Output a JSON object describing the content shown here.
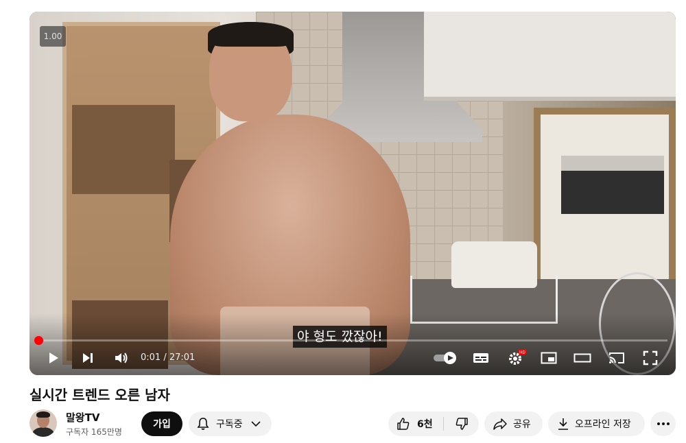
{
  "player": {
    "speed_badge": "1.00",
    "caption": "야 형도 깠잖아!",
    "time_current": "0:01",
    "time_total": "27:01",
    "time_display": "0:01 / 27:01",
    "progress_fraction": 0.0006,
    "settings_badge": "HD",
    "accent_color": "#ff0000",
    "icons": [
      "play-icon",
      "next-icon",
      "volume-icon",
      "autoplay-toggle-icon",
      "subtitles-icon",
      "settings-icon",
      "miniplayer-icon",
      "theater-mode-icon",
      "cast-icon",
      "fullscreen-icon"
    ]
  },
  "video": {
    "title": "실시간 트렌드 오른 남자"
  },
  "channel": {
    "name": "말왕TV",
    "subscribers": "구독자 165만명"
  },
  "actions": {
    "join_label": "가입",
    "subscribed_label": "구독중",
    "like_count": "6천",
    "share_label": "공유",
    "offline_label": "오프라인 저장"
  }
}
